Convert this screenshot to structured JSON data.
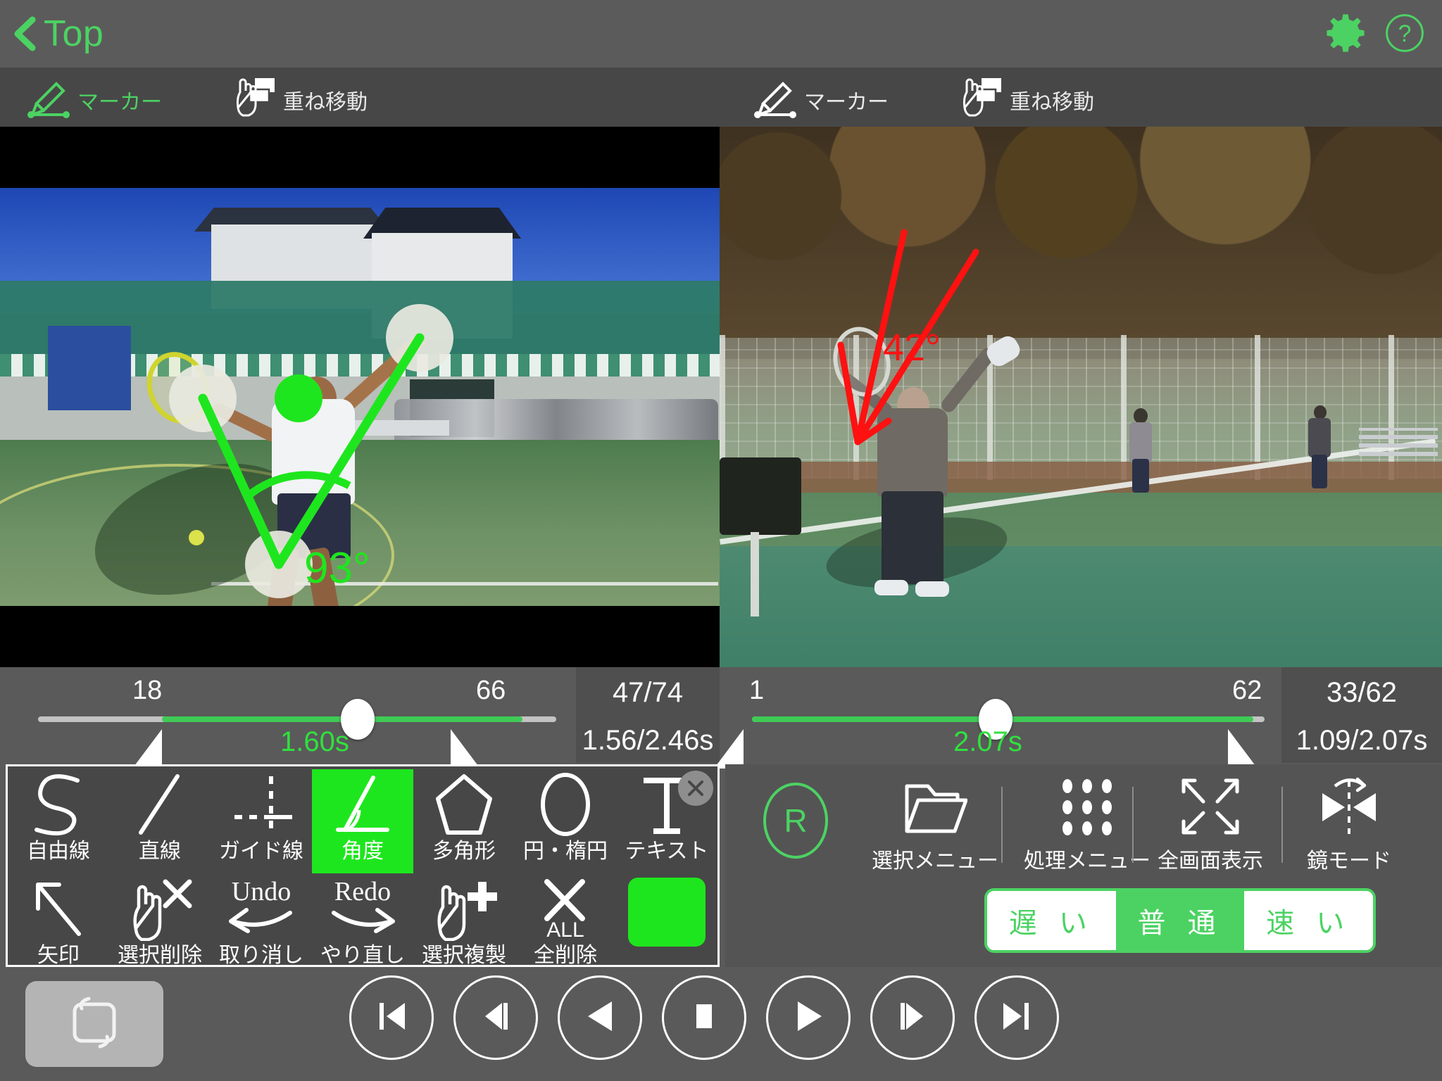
{
  "nav": {
    "back_label": "Top",
    "back_icon": "chevron-left-icon",
    "settings_icon": "gear-icon",
    "help_icon": "question-circle-icon"
  },
  "toolbar": {
    "left": {
      "marker": {
        "label": "マーカー",
        "icon": "marker-pen-icon",
        "active": true
      },
      "overlay_move": {
        "label": "重ね移動",
        "icon": "hand-layers-icon",
        "active": false
      }
    },
    "right": {
      "marker": {
        "label": "マーカー",
        "icon": "marker-pen-icon",
        "active": false
      },
      "overlay_move": {
        "label": "重ね移動",
        "icon": "hand-layers-icon",
        "active": false
      }
    }
  },
  "video_left": {
    "annotation": {
      "type": "angle",
      "value": "93°",
      "color": "#1ee61e"
    }
  },
  "video_right": {
    "annotation": {
      "type": "angle",
      "value": "42°",
      "color": "#ff1111"
    }
  },
  "slider_left": {
    "min": "18",
    "max": "66",
    "current_time": "1.60s",
    "frame_counter": "47/74",
    "time_counter": "1.56/2.46s"
  },
  "slider_right": {
    "min": "1",
    "max": "62",
    "current_time": "2.07s",
    "frame_counter": "33/62",
    "time_counter": "1.09/2.07s"
  },
  "palette": {
    "close_icon": "close-circle-icon",
    "row1": [
      {
        "label": "自由線",
        "icon": "freehand-curve-icon",
        "selected": false
      },
      {
        "label": "直線",
        "icon": "straight-line-icon",
        "selected": false
      },
      {
        "label": "ガイド線",
        "icon": "guide-line-icon",
        "selected": false
      },
      {
        "label": "角度",
        "icon": "angle-icon",
        "selected": true
      },
      {
        "label": "多角形",
        "icon": "polygon-icon",
        "selected": false
      },
      {
        "label": "円・楕円",
        "icon": "ellipse-icon",
        "selected": false
      },
      {
        "label": "テキスト",
        "icon": "text-t-icon",
        "selected": false
      }
    ],
    "row2": [
      {
        "label": "矢印",
        "icon": "arrow-icon",
        "selected": false
      },
      {
        "label": "選択削除",
        "icon": "hand-delete-icon",
        "selected": false
      },
      {
        "label": "取り消し",
        "icon": "undo-icon",
        "badge": "Undo",
        "selected": false
      },
      {
        "label": "やり直し",
        "icon": "redo-icon",
        "badge": "Redo",
        "selected": false
      },
      {
        "label": "選択複製",
        "icon": "hand-duplicate-icon",
        "selected": false
      },
      {
        "label": "全削除",
        "icon": "delete-all-icon",
        "badge": "ALL",
        "selected": false
      },
      {
        "label": "",
        "icon": "color-swatch-icon",
        "selected": false
      }
    ],
    "color_swatch": "#1ee61e"
  },
  "right_panel": {
    "recording_badge": "R",
    "items": [
      {
        "label": "選択メニュー",
        "icon": "folder-icon"
      },
      {
        "label": "処理メニュー",
        "icon": "grid-dots-icon"
      },
      {
        "label": "全画面表示",
        "icon": "expand-arrows-icon"
      },
      {
        "label": "鏡モード",
        "icon": "mirror-mode-icon"
      }
    ],
    "speed": {
      "options": [
        {
          "label": "遅 い",
          "active": false
        },
        {
          "label": "普 通",
          "active": true
        },
        {
          "label": "速 い",
          "active": false
        }
      ]
    }
  },
  "transport": {
    "loop": {
      "icon": "loop-icon"
    },
    "buttons": [
      {
        "icon": "skip-to-start-icon"
      },
      {
        "icon": "step-back-icon"
      },
      {
        "icon": "rewind-icon"
      },
      {
        "icon": "stop-icon"
      },
      {
        "icon": "play-icon"
      },
      {
        "icon": "step-forward-icon"
      },
      {
        "icon": "skip-to-end-icon"
      }
    ]
  },
  "colors": {
    "accent_green": "#4cd263",
    "bright_green": "#1ee61e",
    "red": "#ff1111",
    "chrome": "#5a5a5a",
    "toolbar": "#474747"
  }
}
